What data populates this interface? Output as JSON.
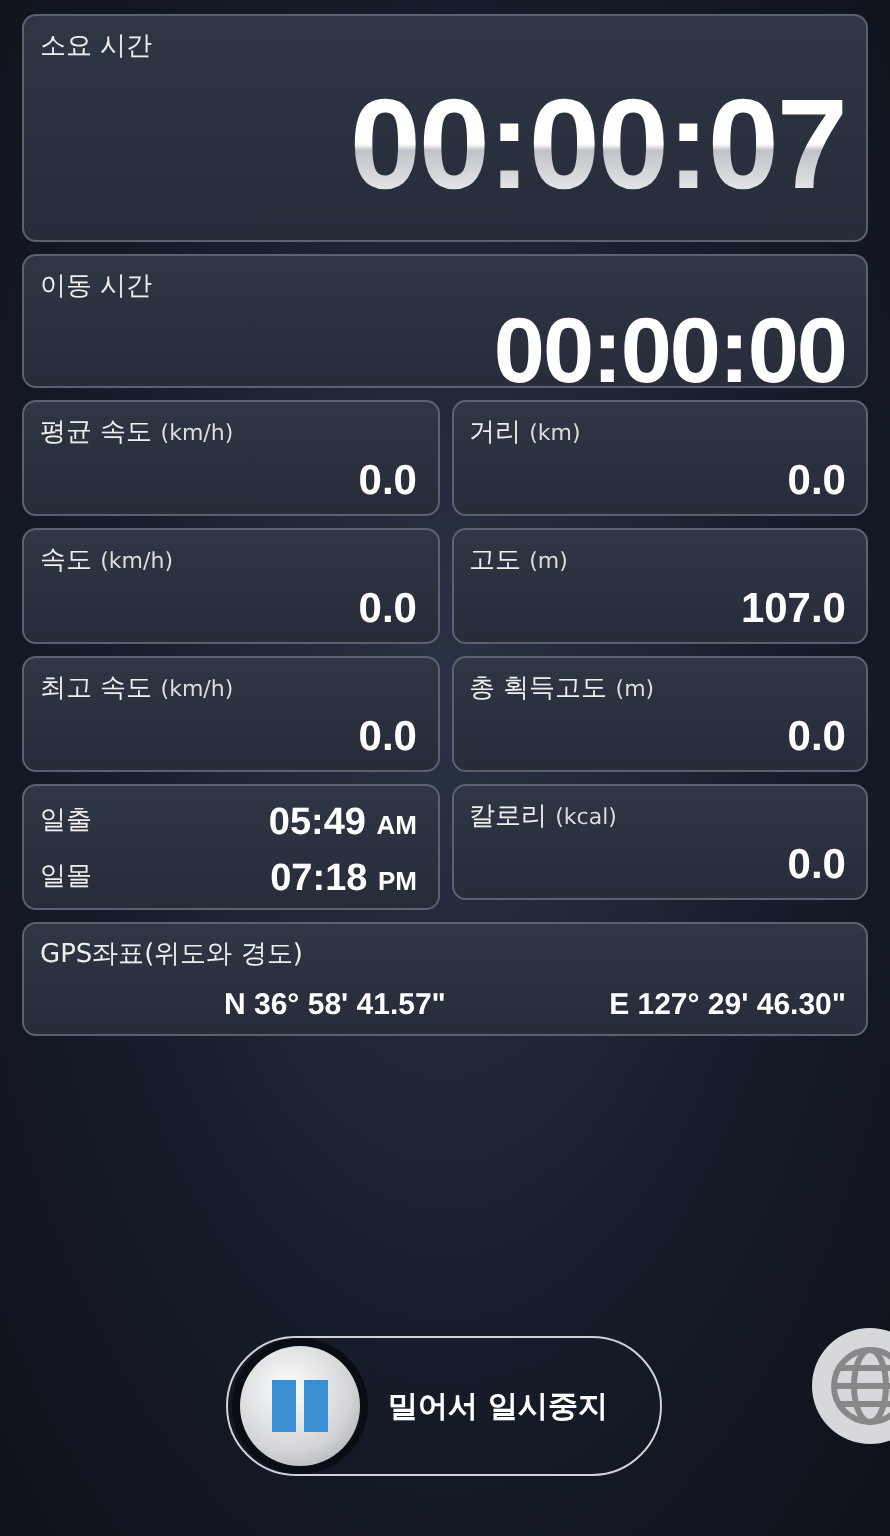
{
  "timers": [
    {
      "label": "소요 시간",
      "value": "00:00:07",
      "kind": "large"
    },
    {
      "label": "이동 시간",
      "value": "00:00:00",
      "kind": "medium"
    }
  ],
  "stats": [
    {
      "kind": "stat",
      "label": "평균 속도",
      "unit": "(km/h)",
      "value": "0.0"
    },
    {
      "kind": "stat",
      "label": "거리",
      "unit": "(km)",
      "value": "0.0"
    },
    {
      "kind": "stat",
      "label": "속도",
      "unit": "(km/h)",
      "value": "0.0"
    },
    {
      "kind": "stat",
      "label": "고도",
      "unit": "(m)",
      "value": "107.0"
    },
    {
      "kind": "stat",
      "label": "최고 속도",
      "unit": "(km/h)",
      "value": "0.0"
    },
    {
      "kind": "stat",
      "label": "총 획득고도",
      "unit": "(m)",
      "value": "0.0"
    },
    {
      "kind": "sun",
      "rows": [
        {
          "label": "일출",
          "time": "05:49",
          "ampm": "AM"
        },
        {
          "label": "일몰",
          "time": "07:18",
          "ampm": "PM"
        }
      ]
    },
    {
      "kind": "stat",
      "label": "칼로리",
      "unit": "(kcal)",
      "value": "0.0"
    }
  ],
  "gps": {
    "label": "GPS좌표(위도와 경도)",
    "latitude": "N 36° 58' 41.57\"",
    "longitude": "E 127° 29' 46.30\""
  },
  "pause_slider": {
    "label": "밀어서 일시중지",
    "level": 0
  }
}
